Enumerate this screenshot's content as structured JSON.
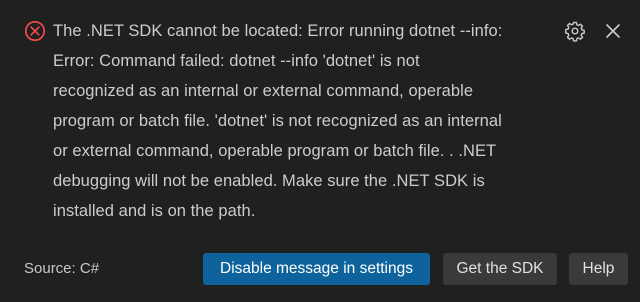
{
  "notification": {
    "severity_icon": "error-circle-x-icon",
    "message_lines": [
      "The .NET SDK cannot be located: Error running dotnet --info:",
      "Error: Command failed: dotnet --info 'dotnet' is not",
      "recognized as an internal or external command, operable",
      "program or batch file. 'dotnet' is not recognized as an internal",
      "or external command, operable program or batch file. . .NET",
      "debugging will not be enabled. Make sure the .NET SDK is",
      "installed and is on the path."
    ],
    "source": "Source: C#",
    "actions": {
      "disable": "Disable message in settings",
      "get_sdk": "Get the SDK",
      "help": "Help"
    },
    "toolbar_icons": [
      "gear-icon",
      "close-icon"
    ]
  },
  "colors": {
    "background": "#202020",
    "text": "#cccccc",
    "error": "#f14c4c",
    "primary_button": "#0e639c",
    "secondary_button": "#3a3a3a"
  }
}
